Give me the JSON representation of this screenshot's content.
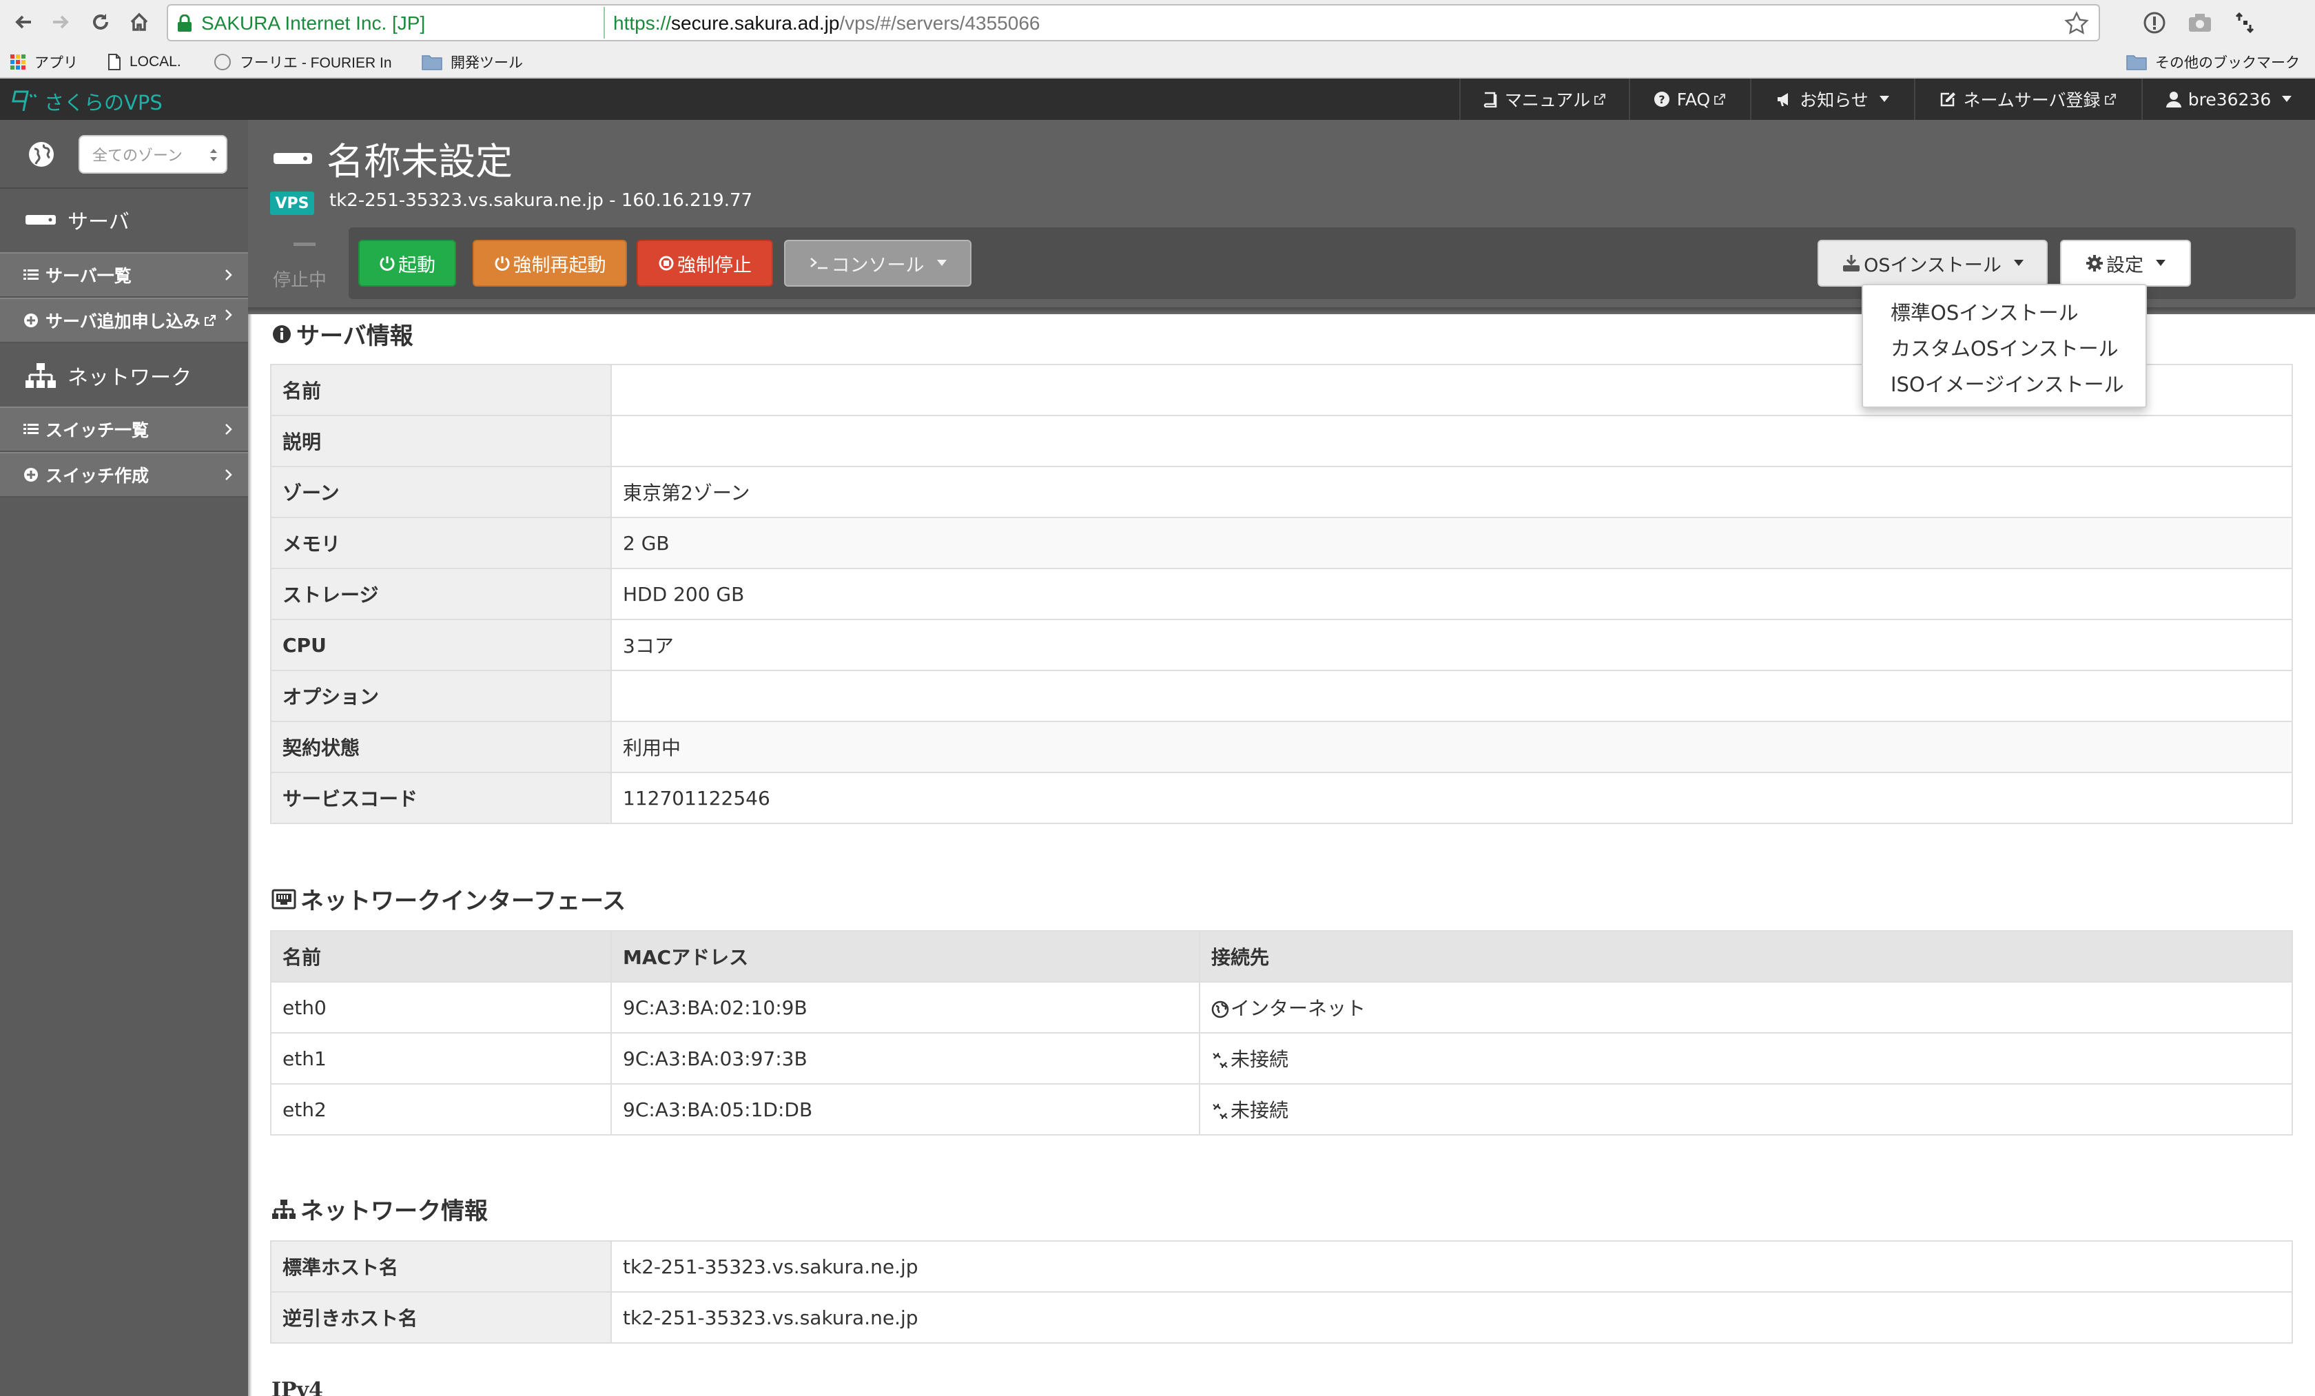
{
  "browser": {
    "ev_label": "SAKURA Internet Inc. [JP]",
    "url_scheme": "https://",
    "url_host": "secure.sakura.ad.jp",
    "url_path": "/vps/#/servers/4355066",
    "bookmarks": [
      {
        "label": "アプリ",
        "icon": "apps-grid-icon"
      },
      {
        "label": "LOCAL.",
        "icon": "page-icon"
      },
      {
        "label": "フーリエ - FOURIER In",
        "icon": "globe-outline-icon"
      },
      {
        "label": "開発ツール",
        "icon": "folder-icon"
      }
    ],
    "other_bookmarks": "その他のブックマーク"
  },
  "header": {
    "brand": "さくらのVPS",
    "nav": [
      {
        "label": "マニュアル",
        "icon": "book-icon",
        "external": true
      },
      {
        "label": "FAQ",
        "icon": "question-circle-icon",
        "external": true
      },
      {
        "label": "お知らせ",
        "icon": "megaphone-icon",
        "dropdown": true
      },
      {
        "label": "ネームサーバ登録",
        "icon": "edit-icon",
        "external": true
      },
      {
        "label": "bre36236",
        "icon": "user-icon",
        "dropdown": true
      }
    ]
  },
  "sidebar": {
    "zone_select": "全てのゾーン",
    "server_heading": "サーバ",
    "server_items": [
      {
        "label": "サーバ一覧",
        "icon": "list-icon"
      },
      {
        "label": "サーバ追加申し込み",
        "icon": "plus-circle-icon",
        "external": true
      }
    ],
    "network_heading": "ネットワーク",
    "network_items": [
      {
        "label": "スイッチ一覧",
        "icon": "list-icon"
      },
      {
        "label": "スイッチ作成",
        "icon": "plus-circle-icon"
      }
    ]
  },
  "server": {
    "name": "名称未設定",
    "badge": "VPS",
    "host_line": "tk2-251-35323.vs.sakura.ne.jp - 160.16.219.77",
    "status": "停止中",
    "actions": {
      "start": "起動",
      "force_restart": "強制再起動",
      "force_stop": "強制停止",
      "console": "コンソール",
      "os_install": "OSインストール",
      "settings": "設定"
    },
    "os_menu": [
      "標準OSインストール",
      "カスタムOSインストール",
      "ISOイメージインストール"
    ]
  },
  "server_info": {
    "title": "サーバ情報",
    "rows": [
      {
        "label": "名前",
        "value": ""
      },
      {
        "label": "説明",
        "value": ""
      },
      {
        "label": "ゾーン",
        "value": "東京第2ゾーン"
      },
      {
        "label": "メモリ",
        "value": "2 GB"
      },
      {
        "label": "ストレージ",
        "value": "HDD 200 GB"
      },
      {
        "label": "CPU",
        "value": "3コア"
      },
      {
        "label": "オプション",
        "value": ""
      },
      {
        "label": "契約状態",
        "value": "利用中"
      },
      {
        "label": "サービスコード",
        "value": "112701122546"
      }
    ]
  },
  "nic": {
    "title": "ネットワークインターフェース",
    "headers": [
      "名前",
      "MACアドレス",
      "接続先"
    ],
    "rows": [
      {
        "name": "eth0",
        "mac": "9C:A3:BA:02:10:9B",
        "dest": "インターネット",
        "dest_icon": "globe-icon"
      },
      {
        "name": "eth1",
        "mac": "9C:A3:BA:03:97:3B",
        "dest": "未接続",
        "dest_icon": "unlink-icon"
      },
      {
        "name": "eth2",
        "mac": "9C:A3:BA:05:1D:DB",
        "dest": "未接続",
        "dest_icon": "unlink-icon"
      }
    ]
  },
  "net_info": {
    "title": "ネットワーク情報",
    "rows": [
      {
        "label": "標準ホスト名",
        "value": "tk2-251-35323.vs.sakura.ne.jp"
      },
      {
        "label": "逆引きホスト名",
        "value": "tk2-251-35323.vs.sakura.ne.jp"
      }
    ]
  },
  "ipv4_label": "IPv4",
  "colors": {
    "brand_teal": "#1fb0a5",
    "start_green": "#23ad4a",
    "restart_orange": "#dc8234",
    "stop_red": "#d9452f",
    "header_dark": "#2e2e2e",
    "sidebar_gray": "#5b5b5b"
  }
}
